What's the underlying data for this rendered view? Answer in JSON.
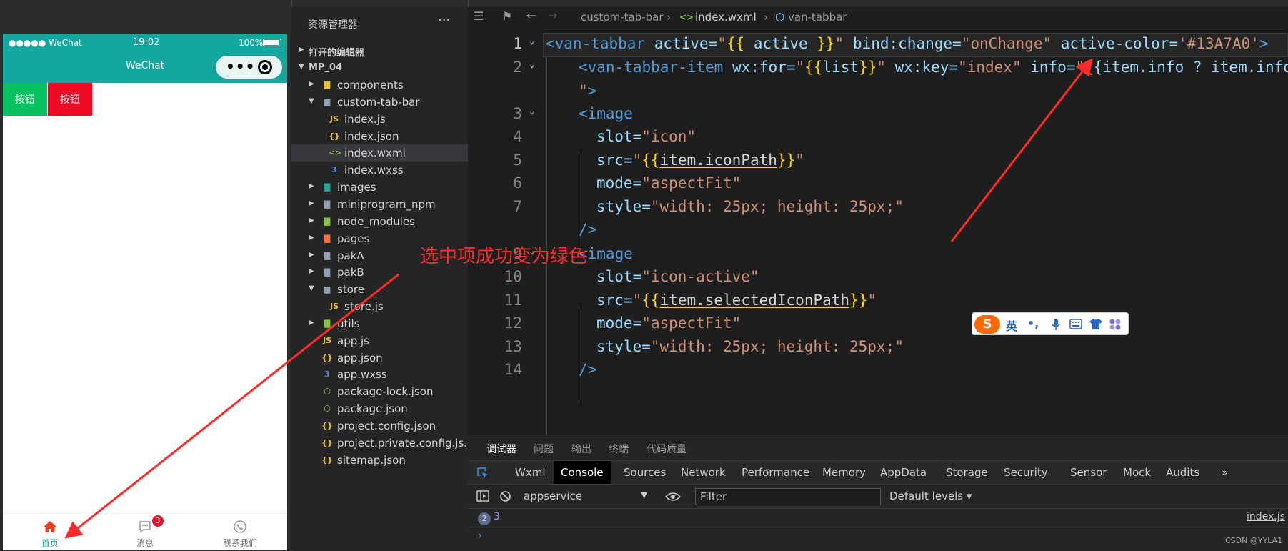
{
  "simulator": {
    "status": {
      "carrier": "●●●●● WeChat",
      "time": "19:02",
      "battery": "100%"
    },
    "nav_title": "WeChat",
    "capsule_more": "•••",
    "buttons": {
      "green": "按钮",
      "red": "按钮"
    },
    "tabbar": {
      "tabs": [
        {
          "label": "首页",
          "icon": "home-icon",
          "active": true
        },
        {
          "label": "消息",
          "icon": "chat-icon",
          "badge": "3"
        },
        {
          "label": "联系我们",
          "icon": "phone-icon"
        }
      ]
    },
    "colors": {
      "theme": "#13a79f",
      "green": "#07c160",
      "red": "#ee0a24"
    }
  },
  "explorer": {
    "title": "资源管理器",
    "more": "···",
    "open_editors": "打开的编辑器",
    "project": "MP_04",
    "items": [
      {
        "label": "components",
        "type": "folder",
        "icon": "folder-icon"
      },
      {
        "label": "custom-tab-bar",
        "type": "folder-open",
        "icon": "folder-open-icon"
      },
      {
        "label": "index.js",
        "type": "js",
        "icon": "js-file-icon"
      },
      {
        "label": "index.json",
        "type": "json",
        "icon": "json-file-icon"
      },
      {
        "label": "index.wxml",
        "type": "wxml",
        "icon": "wxml-file-icon",
        "selected": true
      },
      {
        "label": "index.wxss",
        "type": "wxss",
        "icon": "css-file-icon"
      },
      {
        "label": "images",
        "type": "folder",
        "icon": "folder-icon"
      },
      {
        "label": "miniprogram_npm",
        "type": "folder",
        "icon": "folder-icon"
      },
      {
        "label": "node_modules",
        "type": "folder",
        "icon": "folder-icon"
      },
      {
        "label": "pages",
        "type": "folder",
        "icon": "folder-icon"
      },
      {
        "label": "pakA",
        "type": "folder",
        "icon": "folder-icon"
      },
      {
        "label": "pakB",
        "type": "folder",
        "icon": "folder-icon"
      },
      {
        "label": "store",
        "type": "folder-open",
        "icon": "folder-open-icon"
      },
      {
        "label": "store.js",
        "type": "js",
        "icon": "js-file-icon"
      },
      {
        "label": "utils",
        "type": "folder",
        "icon": "folder-icon"
      },
      {
        "label": "app.js",
        "type": "js",
        "icon": "js-file-icon"
      },
      {
        "label": "app.json",
        "type": "json",
        "icon": "json-file-icon"
      },
      {
        "label": "app.wxss",
        "type": "wxss",
        "icon": "css-file-icon"
      },
      {
        "label": "package-lock.json",
        "type": "node",
        "icon": "node-file-icon"
      },
      {
        "label": "package.json",
        "type": "node",
        "icon": "node-file-icon"
      },
      {
        "label": "project.config.json",
        "type": "json",
        "icon": "json-file-icon"
      },
      {
        "label": "project.private.config.js...",
        "type": "json",
        "icon": "json-file-icon"
      },
      {
        "label": "sitemap.json",
        "type": "json",
        "icon": "json-file-icon"
      }
    ]
  },
  "editor": {
    "breadcrumbs": [
      "custom-tab-bar",
      "index.wxml",
      "van-tabbar"
    ],
    "line_numbers": [
      "1",
      "2",
      "",
      "3",
      "4",
      "5",
      "6",
      "7",
      "",
      "9",
      "10",
      "11",
      "12",
      "13",
      "14"
    ],
    "code": {
      "l1": {
        "tag": "<van-tabbar",
        "a1": " active=",
        "s1": "\"",
        "b1": "{{",
        "e1": " active ",
        "b2": "}}",
        "s2": "\"",
        "a2": " bind:change=",
        "s3": "\"onChange\"",
        "a3": " active-color=",
        "s4": "'#13A7A0'",
        "end": ">"
      },
      "l2": {
        "tag": "<van-tabbar-item",
        "a1": " wx:for=",
        "s1": "\"",
        "b1": "{{",
        "e1": "list",
        "b2": "}}",
        "s2": "\"",
        "a2": " wx:key=",
        "s3": "\"index\"",
        "a3": " info=",
        "s4": "\"",
        "b3": "{",
        "e2": "{item.info ? item.info"
      },
      "l2b": {
        "s": "\"",
        "end": ">"
      },
      "l3": {
        "tag": "<image"
      },
      "l4": {
        "a": "slot=",
        "s": "\"icon\""
      },
      "l5": {
        "a": "src=",
        "s1": "\"",
        "b1": "{{",
        "e": "item.iconPath",
        "b2": "}}",
        "s2": "\""
      },
      "l6": {
        "a": "mode=",
        "s": "\"aspectFit\""
      },
      "l7": {
        "a": "style=",
        "s": "\"width: 25px; height: 25px;\""
      },
      "l8": {
        "end": "/>"
      },
      "l9": {
        "tag": "<image"
      },
      "l10": {
        "a": "slot=",
        "s": "\"icon-active\""
      },
      "l11": {
        "a": "src=",
        "s1": "\"",
        "b1": "{{",
        "e": "item.selectedIconPath",
        "b2": "}}",
        "s2": "\""
      },
      "l12": {
        "a": "mode=",
        "s": "\"aspectFit\""
      },
      "l13": {
        "a": "style=",
        "s": "\"width: 25px; height: 25px;\""
      },
      "l14": {
        "end": "/>"
      }
    }
  },
  "ime": {
    "logo": "S",
    "lang": "英",
    "punct": "•,",
    "items": [
      "mic-icon",
      "keyboard-icon",
      "shirt-icon",
      "apps-icon"
    ]
  },
  "devtools": {
    "top_tabs": [
      "调试器",
      "问题",
      "输出",
      "终端",
      "代码质量"
    ],
    "panels": [
      "Wxml",
      "Console",
      "Sources",
      "Network",
      "Performance",
      "Memory",
      "AppData",
      "Storage",
      "Security",
      "Sensor",
      "Mock",
      "Audits",
      "»"
    ],
    "context": "appservice",
    "filter_placeholder": "Filter",
    "levels": "Default levels ▾",
    "log": {
      "count": "2",
      "value": "3",
      "source": "index.js"
    },
    "prompt": "›",
    "watermark": "CSDN @YYLA1"
  },
  "annotation": {
    "text": "选中项成功变为绿色",
    "color": "#ff2a2a"
  }
}
